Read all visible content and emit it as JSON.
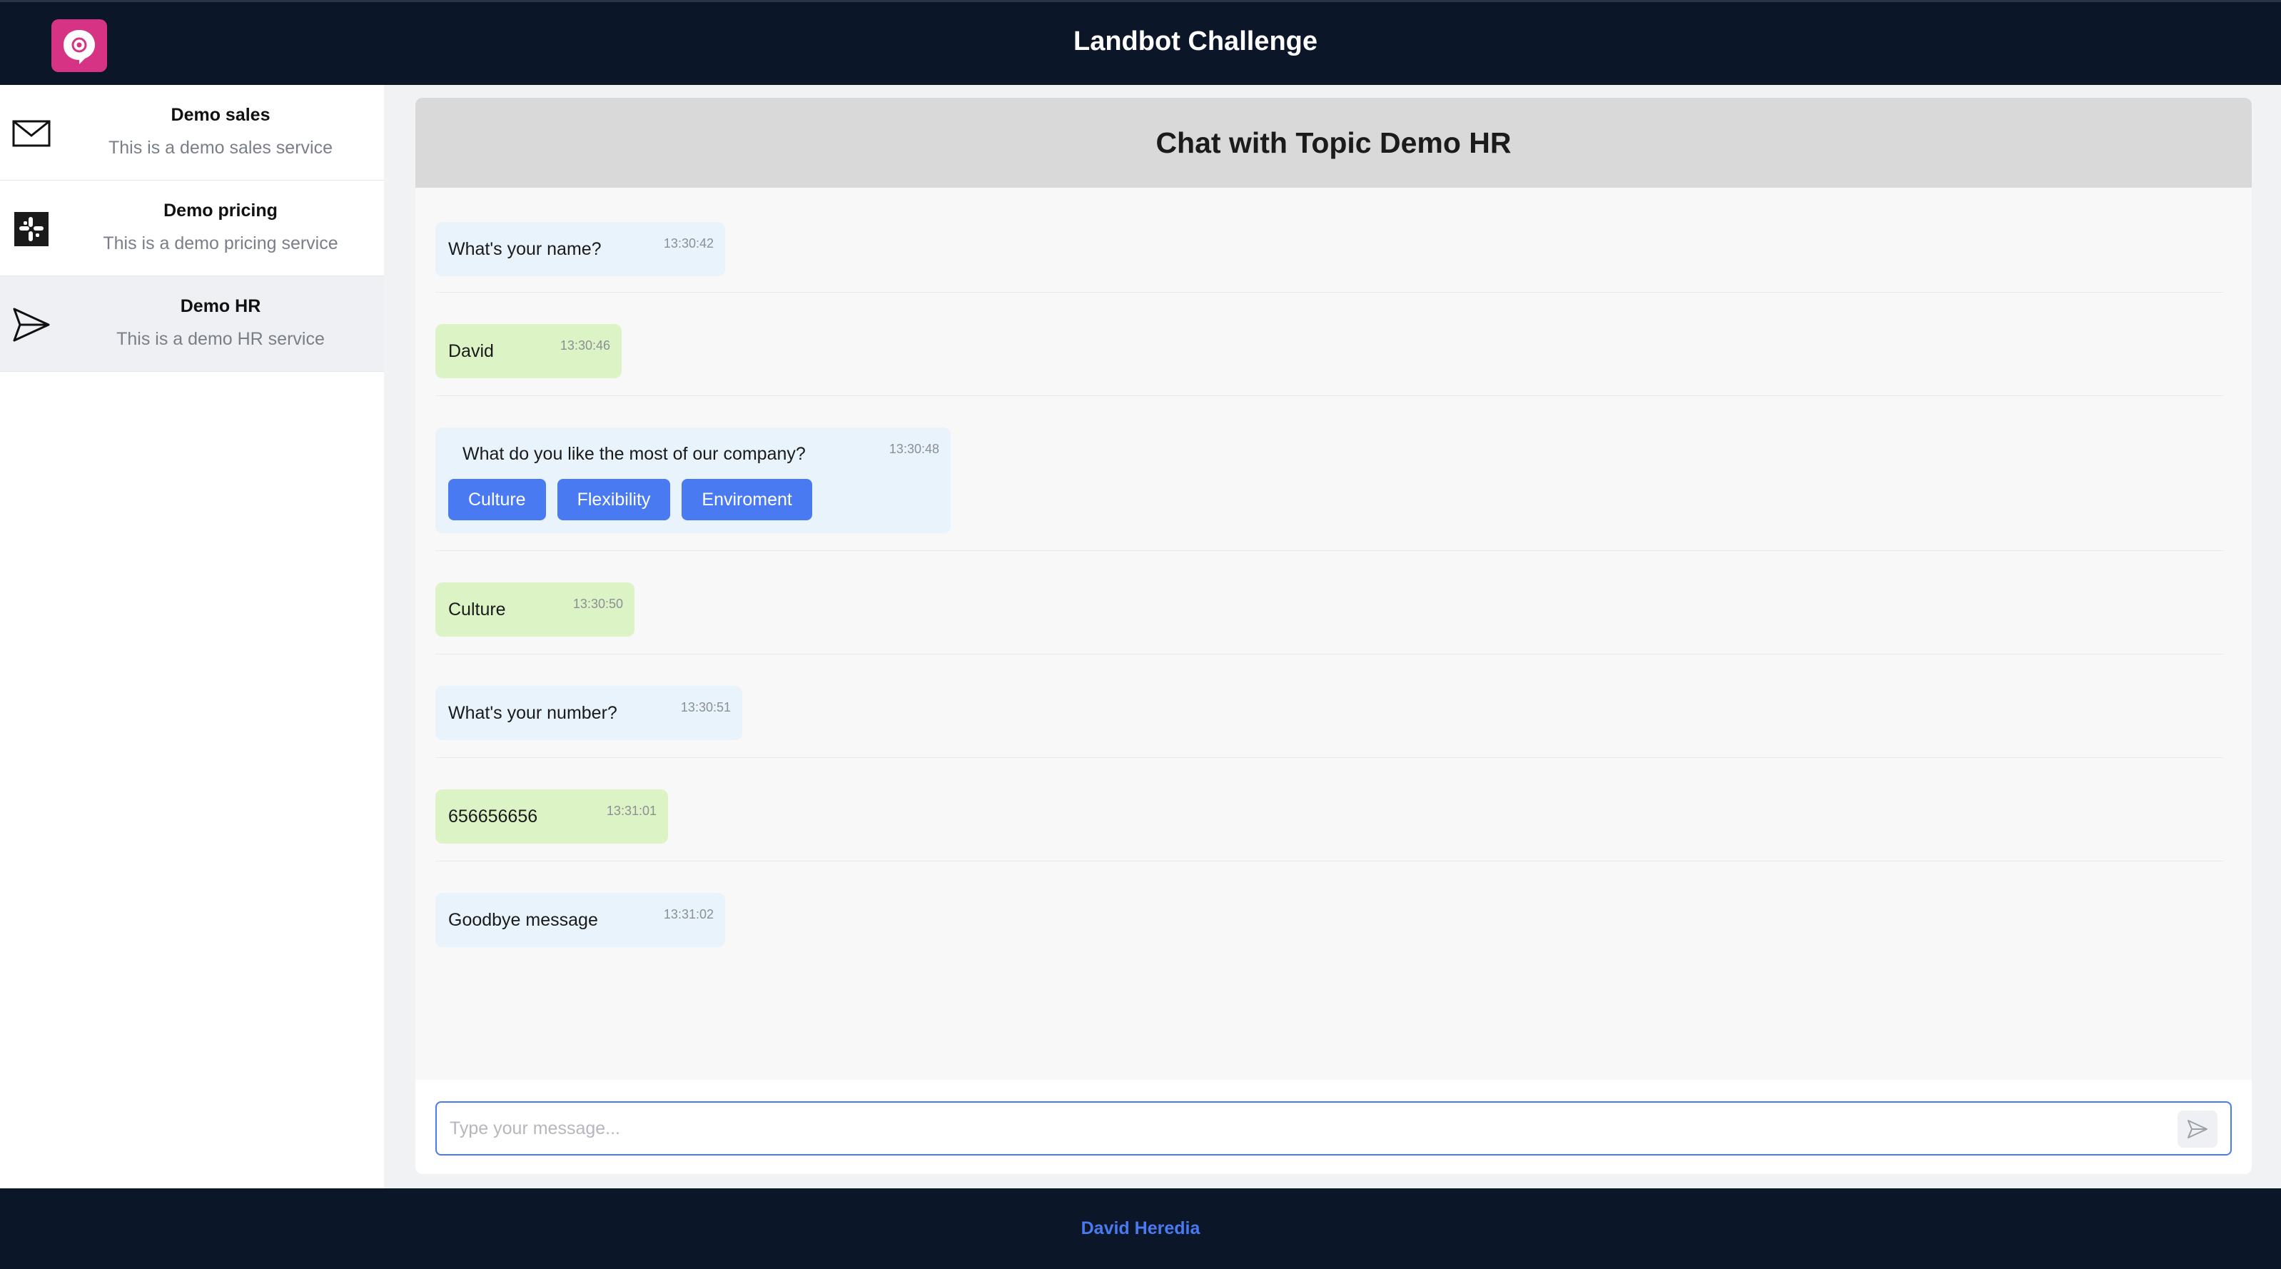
{
  "app": {
    "title": "Landbot Challenge",
    "logo_icon": "chat-bubble-icon",
    "logo_color": "#d63384"
  },
  "sidebar": {
    "topics": [
      {
        "name": "Demo sales",
        "description": "This is a demo sales service",
        "icon": "envelope-icon",
        "active": false
      },
      {
        "name": "Demo pricing",
        "description": "This is a demo pricing service",
        "icon": "slack-icon",
        "active": false
      },
      {
        "name": "Demo HR",
        "description": "This is a demo HR service",
        "icon": "send-icon",
        "active": true
      }
    ]
  },
  "chat": {
    "title": "Chat with Topic Demo HR",
    "messages": [
      {
        "from": "bot",
        "text": "What's your name?",
        "time": "13:30:42"
      },
      {
        "from": "user",
        "text": "David",
        "time": "13:30:46"
      },
      {
        "from": "bot",
        "text": "What do you like the most of our company?",
        "time": "13:30:48",
        "options": [
          "Culture",
          "Flexibility",
          "Enviroment"
        ]
      },
      {
        "from": "user",
        "text": "Culture",
        "time": "13:30:50"
      },
      {
        "from": "bot",
        "text": "What's your number?",
        "time": "13:30:51"
      },
      {
        "from": "user",
        "text": "656656656",
        "time": "13:31:01"
      },
      {
        "from": "bot",
        "text": "Goodbye message",
        "time": "13:31:02"
      }
    ],
    "input": {
      "value": "",
      "placeholder": "Type your message..."
    },
    "send_icon": "send-icon"
  },
  "footer": {
    "author": "David Heredia"
  },
  "colors": {
    "header_bg": "#0b1628",
    "accent": "#4a7af2",
    "bot_bubble": "#e9f3fc",
    "user_bubble": "#dcf3c6"
  }
}
